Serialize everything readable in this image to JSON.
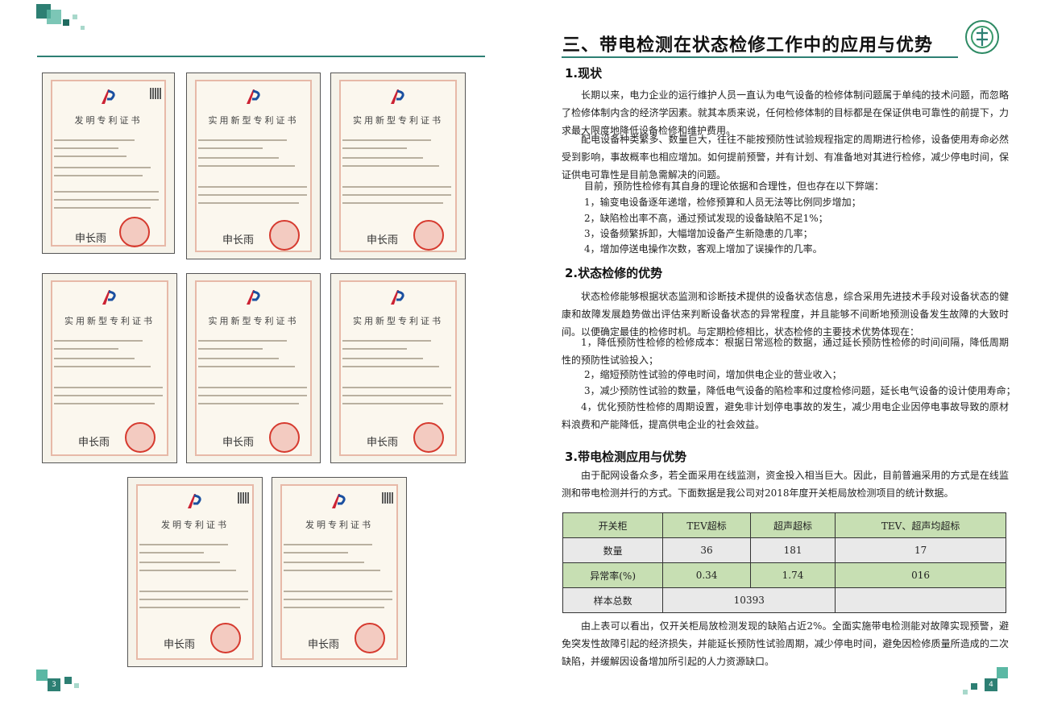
{
  "page": {
    "left_page_number": "3",
    "right_page_number": "4",
    "accent_color": "#2d7f73"
  },
  "emblem": {
    "text": "电力"
  },
  "certificates": [
    {
      "title": "发明专利证书",
      "signature": "申长雨"
    },
    {
      "title": "实用新型专利证书",
      "signature": "申长雨"
    },
    {
      "title": "实用新型专利证书",
      "signature": "申长雨"
    },
    {
      "title": "实用新型专利证书",
      "signature": "申长雨"
    },
    {
      "title": "实用新型专利证书",
      "signature": "申长雨"
    },
    {
      "title": "实用新型专利证书",
      "signature": "申长雨"
    },
    {
      "title": "发明专利证书",
      "signature": "申长雨"
    },
    {
      "title": "发明专利证书",
      "signature": "申长雨"
    }
  ],
  "section_title": "三、带电检测在状态检修工作中的应用与优势",
  "s1": {
    "heading": "1.现状",
    "p1": "长期以来，电力企业的运行维护人员一直认为电气设备的检修体制问题属于单纯的技术问题，而忽略了检修体制内含的经济学因素。就其本质来说，任何检修体制的目标都是在保证供电可靠性的前提下，力求最大限度地降低设备检修和维护费用。",
    "p2": "配电设备种类繁多、数量巨大，往往不能按预防性试验规程指定的周期进行检修，设备使用寿命必然受到影响，事故概率也相应增加。如何提前预警，并有计划、有准备地对其进行检修，减少停电时间，保证供电可靠性是目前急需解决的问题。",
    "p3": "目前，预防性检修有其自身的理论依据和合理性，但也存在以下弊端：",
    "items": [
      "1，输变电设备逐年递增，检修预算和人员无法等比例同步增加；",
      "2，缺陷检出率不高，通过预试发现的设备缺陷不足1%；",
      "3，设备频繁拆卸，大幅增加设备产生新隐患的几率；",
      "4，增加停送电操作次数，客观上增加了误操作的几率。"
    ]
  },
  "s2": {
    "heading": "2.状态检修的优势",
    "p1": "状态检修能够根据状态监测和诊断技术提供的设备状态信息，综合采用先进技术手段对设备状态的健康和故障发展趋势做出评估来判断设备状态的异常程度，并且能够不间断地预测设备发生故障的大致时间。以便确定最佳的检修时机。与定期检修相比，状态检修的主要技术优势体现在：",
    "items": [
      "1，降低预防性检修的检修成本：根据日常巡检的数据，通过延长预防性检修的时间间隔，降低周期性的预防性试验投入；",
      "2，缩短预防性试验的停电时间，增加供电企业的营业收入；",
      "3，减少预防性试验的数量，降低电气设备的陷检率和过度检修问题，延长电气设备的设计使用寿命；",
      "4，优化预防性检修的周期设置，避免非计划停电事故的发生，减少用电企业因停电事故导致的原材料浪费和产能降低，提高供电企业的社会效益。"
    ]
  },
  "s3": {
    "heading": "3.带电检测应用与优势",
    "p1": "由于配网设备众多，若全面采用在线监测，资金投入相当巨大。因此，目前普遍采用的方式是在线监测和带电检测并行的方式。下面数据是我公司对2018年度开关柜局放检测项目的统计数据。",
    "table": {
      "headers": [
        "开关柜",
        "TEV超标",
        "超声超标",
        "TEV、超声均超标"
      ],
      "rows": [
        [
          "数量",
          "36",
          "181",
          "17"
        ],
        [
          "异常率(%)",
          "0.34",
          "1.74",
          "016"
        ]
      ],
      "total_label": "样本总数",
      "total_value": "10393"
    },
    "p2": "由上表可以看出，仅开关柜局放检测发现的缺陷占近2%。全面实施带电检测能对故障实现预警，避免突发性故障引起的经济损失，并能延长预防性试验周期，减少停电时间，避免因检修质量所造成的二次缺陷，并缓解因设备增加所引起的人力资源缺口。"
  }
}
